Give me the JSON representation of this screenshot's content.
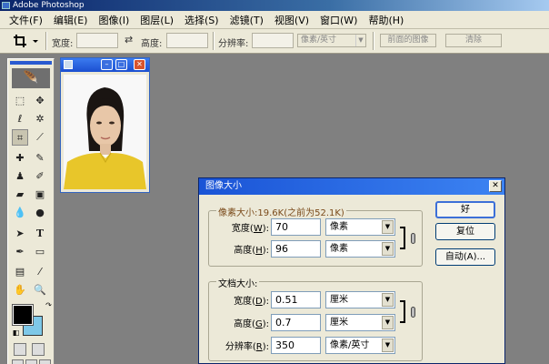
{
  "app": {
    "title": "Adobe Photoshop"
  },
  "menu": [
    "文件(F)",
    "编辑(E)",
    "图像(I)",
    "图层(L)",
    "选择(S)",
    "滤镜(T)",
    "视图(V)",
    "窗口(W)",
    "帮助(H)"
  ],
  "options_bar": {
    "width_label": "宽度:",
    "height_label": "高度:",
    "resolution_label": "分辨率:",
    "unit_value": "像素/英寸",
    "front_image_button": "前面的图像",
    "clear_button": "清除"
  },
  "dialog": {
    "title": "图像大小",
    "pixel_dimensions_label": "像素大小:19.6K(之前为52.1K)",
    "width_label": "宽度(",
    "width_key": "W",
    "width_value": "70",
    "width_unit": "像素",
    "height_label": "高度(",
    "height_key": "H",
    "height_value": "96",
    "height_unit": "像素",
    "document_size_label": "文档大小:",
    "doc_width_label": "宽度(",
    "doc_width_key": "D",
    "doc_width_value": "0.51",
    "doc_width_unit": "厘米",
    "doc_height_label": "高度(",
    "doc_height_key": "G",
    "doc_height_value": "0.7",
    "doc_height_unit": "厘米",
    "resolution_label": "分辨率(",
    "resolution_key": "R",
    "resolution_value": "350",
    "resolution_unit": "像素/英寸",
    "label_end": "):",
    "ok_button": "好",
    "reset_button": "复位",
    "auto_button": "自动(A)..."
  },
  "colors": {
    "foreground": "#000000",
    "background": "#7ec8e8",
    "title_blue": "#1a54d6"
  },
  "icons": [
    "crop-icon",
    "swap-arrows-icon",
    "marquee-icon",
    "move-icon",
    "lasso-icon",
    "magic-wand-icon",
    "heal-icon",
    "brush-icon",
    "stamp-icon",
    "history-brush-icon",
    "eraser-icon",
    "gradient-icon",
    "blur-icon",
    "dodge-icon",
    "path-select-icon",
    "type-icon",
    "pen-icon",
    "shape-icon",
    "notes-icon",
    "eyedropper-icon",
    "hand-icon",
    "zoom-icon",
    "chain-link-icon"
  ]
}
